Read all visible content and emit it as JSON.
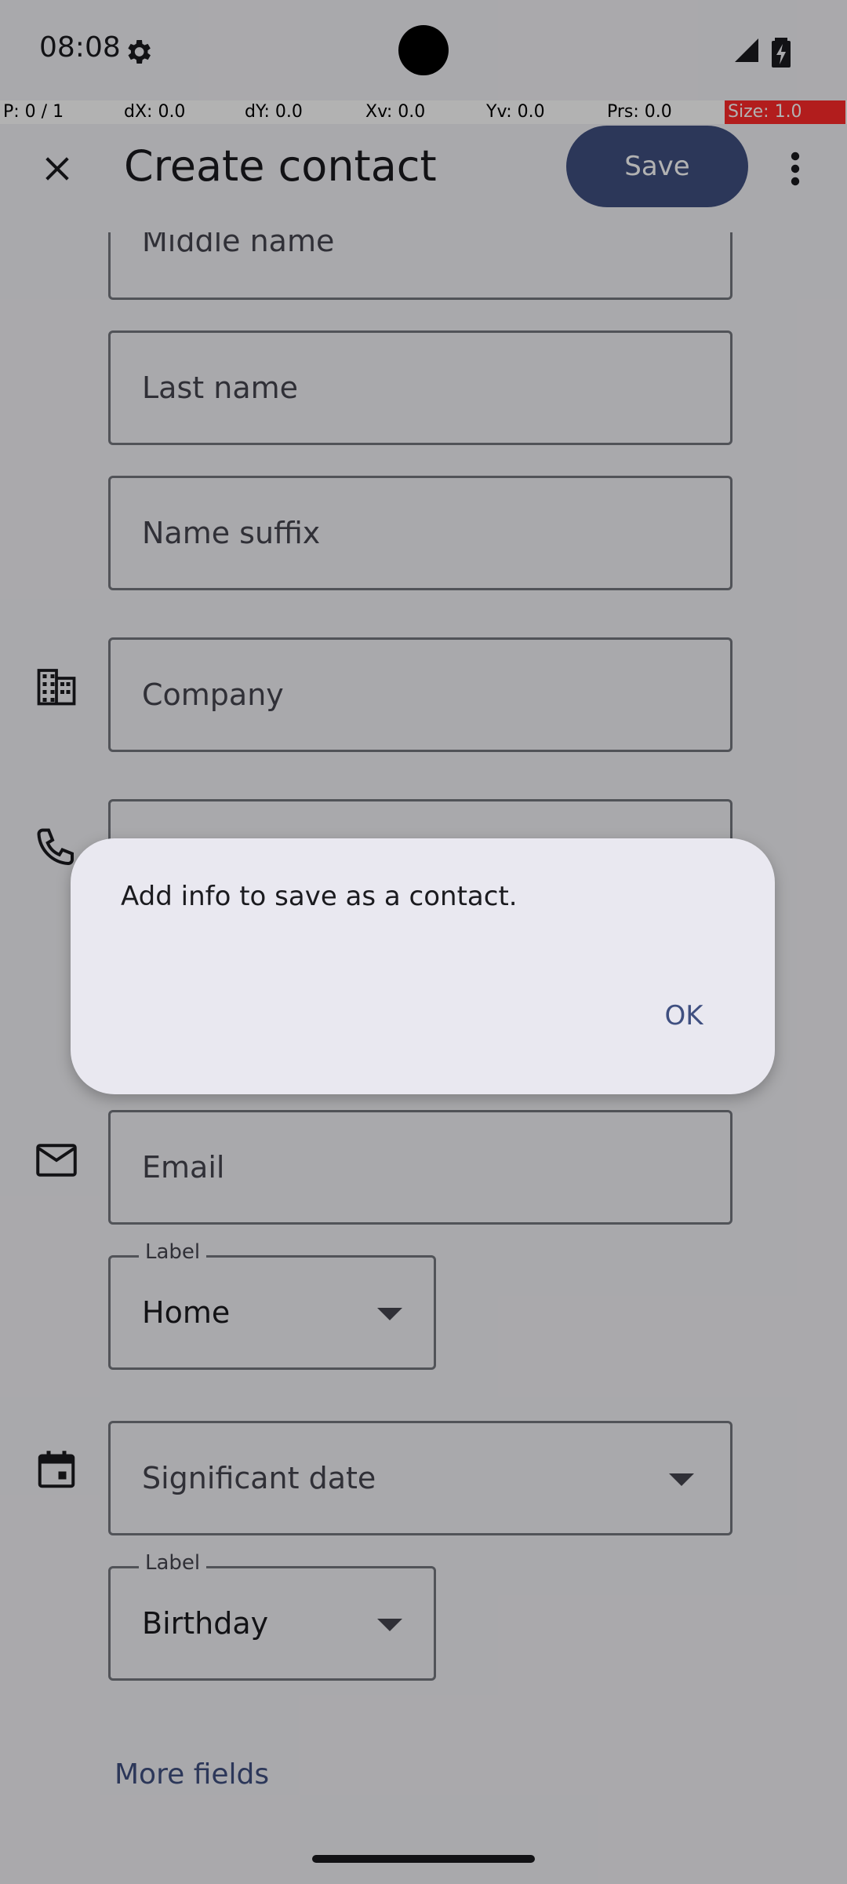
{
  "status_bar": {
    "time": "08:08"
  },
  "debug_overlay": {
    "cells": [
      "P: 0 / 1",
      "dX: 0.0",
      "dY: 0.0",
      "Xv: 0.0",
      "Yv: 0.0",
      "Prs: 0.0",
      "Size: 1.0"
    ]
  },
  "app_bar": {
    "title": "Create contact",
    "save_label": "Save",
    "close_icon": "close-icon",
    "more_icon": "more-vert-icon"
  },
  "form": {
    "middle_name_placeholder": "Middle name",
    "last_name_placeholder": "Last name",
    "name_suffix_placeholder": "Name suffix",
    "company_placeholder": "Company",
    "email_placeholder": "Email",
    "email_label_legend": "Label",
    "email_label_value": "Home",
    "significant_date_placeholder": "Significant date",
    "date_label_legend": "Label",
    "date_label_value": "Birthday",
    "more_fields_label": "More fields"
  },
  "dialog": {
    "message": "Add info to save as a contact.",
    "ok_label": "OK"
  },
  "colors": {
    "primary": "#3f4f80",
    "surface": "#f3f2f7",
    "dialog_surface": "#e9e8f0",
    "outline": "#74777f"
  }
}
